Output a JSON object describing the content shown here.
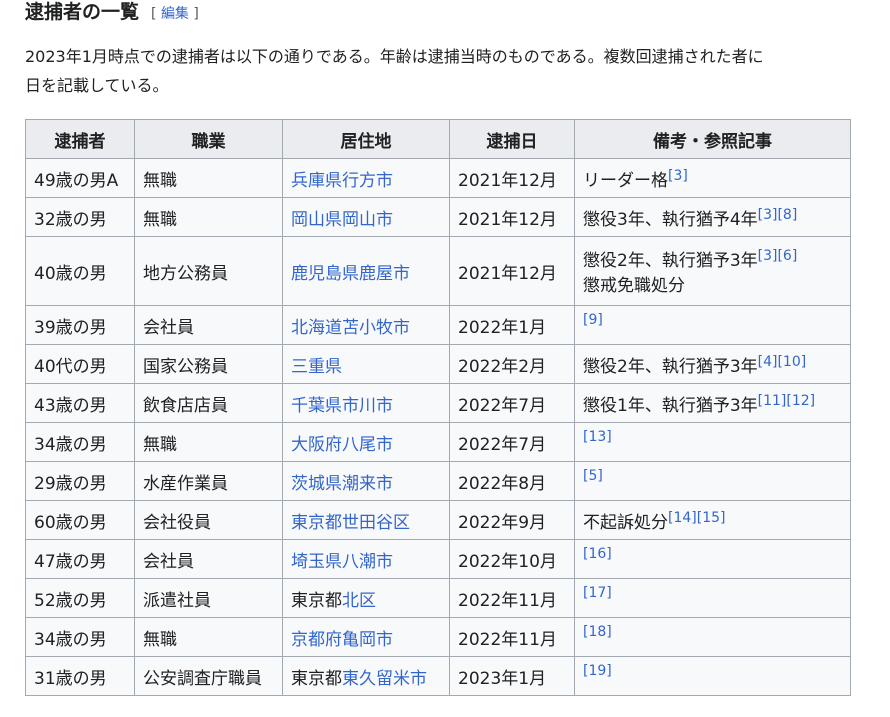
{
  "heading": {
    "title": "逮捕者の一覧",
    "edit_open": "[",
    "edit_label": "編集",
    "edit_close": "]"
  },
  "intro": {
    "line1": "2023年1月時点での逮捕者は以下の通りである。年齢は逮捕当時のものである。複数回逮捕された者に",
    "line2": "日を記載している。"
  },
  "table": {
    "headers": [
      "逮捕者",
      "職業",
      "居住地",
      "逮捕日",
      "備考・参照記事"
    ],
    "rows": [
      {
        "person": "49歳の男A",
        "job": "無職",
        "place_prefix": "",
        "place_link": "兵庫県行方市",
        "date": "2021年12月",
        "note": "リーダー格",
        "note2": "",
        "refs": "[3]"
      },
      {
        "person": "32歳の男",
        "job": "無職",
        "place_prefix": "",
        "place_link": "岡山県岡山市",
        "date": "2021年12月",
        "note": "懲役3年、執行猶予4年",
        "note2": "",
        "refs": "[3][8]"
      },
      {
        "person": "40歳の男",
        "job": "地方公務員",
        "place_prefix": "",
        "place_link": "鹿児島県鹿屋市",
        "date": "2021年12月",
        "note": "懲役2年、執行猶予3年",
        "note2": "懲戒免職処分",
        "refs": "[3][6]"
      },
      {
        "person": "39歳の男",
        "job": "会社員",
        "place_prefix": "",
        "place_link": "北海道苫小牧市",
        "date": "2022年1月",
        "note": "",
        "note2": "",
        "refs": "[9]"
      },
      {
        "person": "40代の男",
        "job": "国家公務員",
        "place_prefix": "",
        "place_link": "三重県",
        "date": "2022年2月",
        "note": "懲役2年、執行猶予3年",
        "note2": "",
        "refs": "[4][10]"
      },
      {
        "person": "43歳の男",
        "job": "飲食店店員",
        "place_prefix": "",
        "place_link": "千葉県市川市",
        "date": "2022年7月",
        "note": "懲役1年、執行猶予3年",
        "note2": "",
        "refs": "[11][12]"
      },
      {
        "person": "34歳の男",
        "job": "無職",
        "place_prefix": "",
        "place_link": "大阪府八尾市",
        "date": "2022年7月",
        "note": "",
        "note2": "",
        "refs": "[13]"
      },
      {
        "person": "29歳の男",
        "job": "水産作業員",
        "place_prefix": "",
        "place_link": "茨城県潮来市",
        "date": "2022年8月",
        "note": "",
        "note2": "",
        "refs": "[5]"
      },
      {
        "person": "60歳の男",
        "job": "会社役員",
        "place_prefix": "",
        "place_link": "東京都世田谷区",
        "date": "2022年9月",
        "note": "不起訴処分",
        "note2": "",
        "refs": "[14][15]"
      },
      {
        "person": "47歳の男",
        "job": "会社員",
        "place_prefix": "",
        "place_link": "埼玉県八潮市",
        "date": "2022年10月",
        "note": "",
        "note2": "",
        "refs": "[16]"
      },
      {
        "person": "52歳の男",
        "job": "派遣社員",
        "place_prefix": "東京都",
        "place_link": "北区",
        "date": "2022年11月",
        "note": "",
        "note2": "",
        "refs": "[17]"
      },
      {
        "person": "34歳の男",
        "job": "無職",
        "place_prefix": "",
        "place_link": "京都府亀岡市",
        "date": "2022年11月",
        "note": "",
        "note2": "",
        "refs": "[18]"
      },
      {
        "person": "31歳の男",
        "job": "公安調査庁職員",
        "place_prefix": "東京都",
        "place_link": "東久留米市",
        "date": "2023年1月",
        "note": "",
        "note2": "",
        "refs": "[19]"
      }
    ]
  }
}
